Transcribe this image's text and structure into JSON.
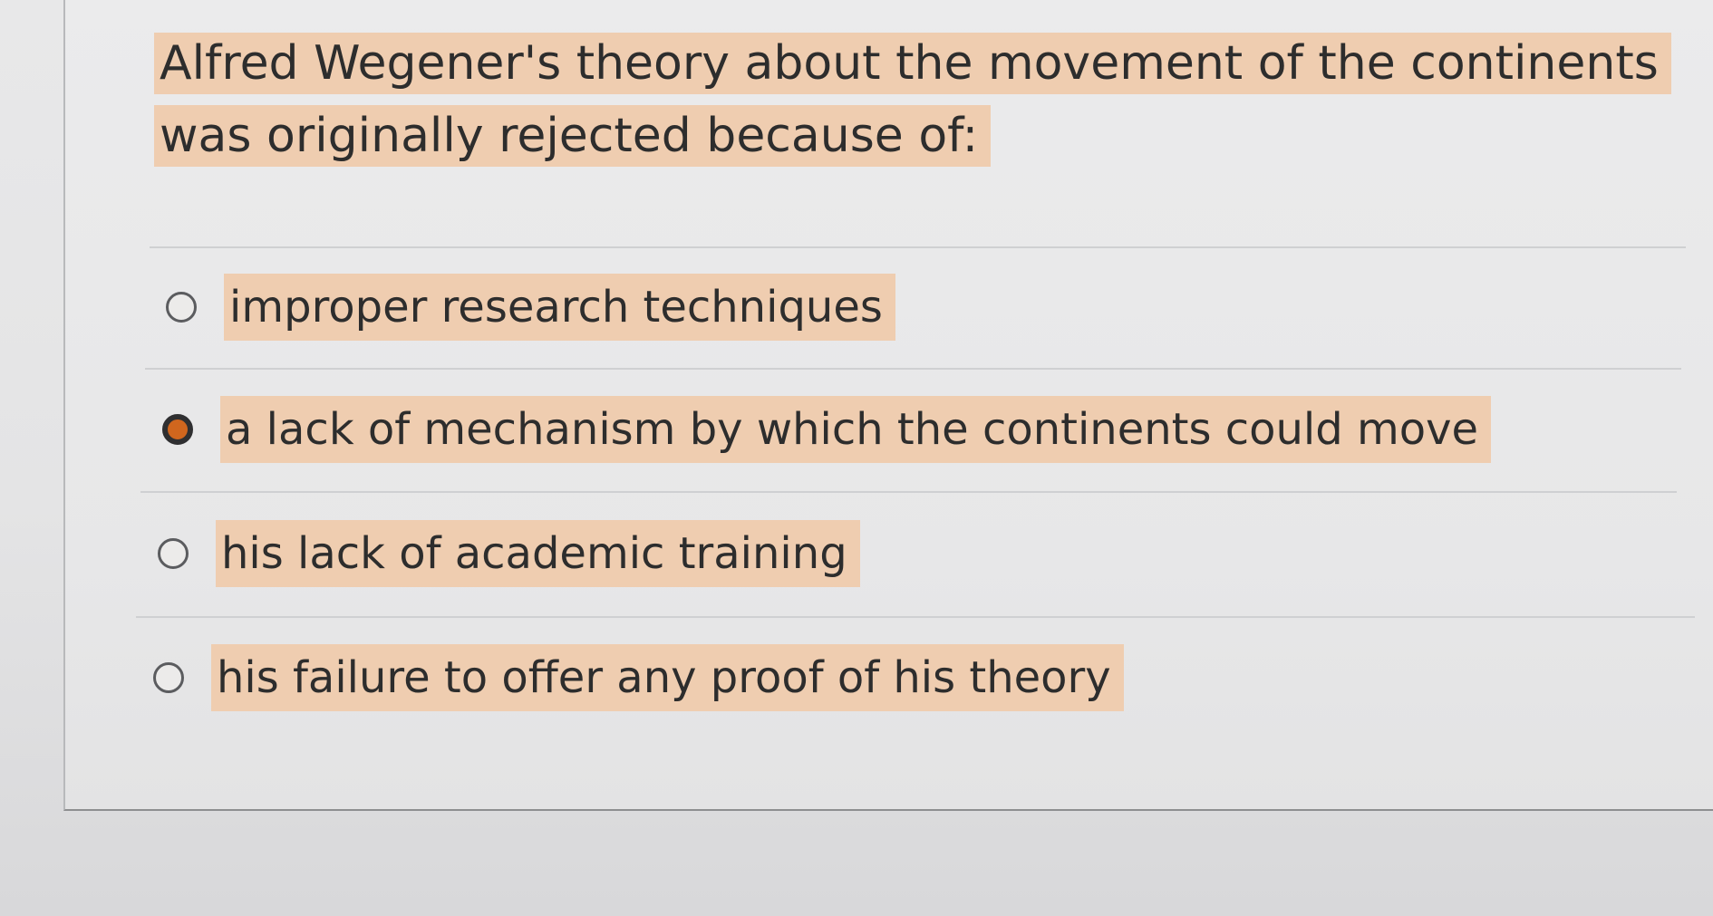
{
  "question": {
    "text": "Alfred Wegener's theory about the movement of the continents was originally rejected because of:"
  },
  "options": [
    {
      "label": "improper research techniques",
      "selected": false
    },
    {
      "label": "a lack of mechanism by which the continents could move",
      "selected": true
    },
    {
      "label": "his lack of academic training",
      "selected": false
    },
    {
      "label": "his failure to offer any proof of his theory",
      "selected": false
    }
  ],
  "colors": {
    "highlight": "#efcdb0",
    "radio_selected_fill": "#d0661e",
    "radio_border": "#5b5c5f"
  }
}
